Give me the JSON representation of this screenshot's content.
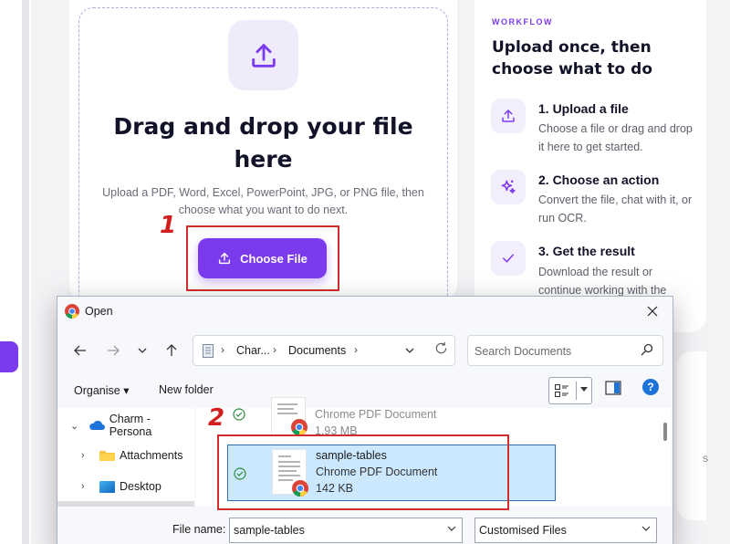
{
  "upload": {
    "title": "Drag and drop your file here",
    "subtitle": "Upload a PDF, Word, Excel, PowerPoint, JPG, or PNG file, then choose what you want to do next.",
    "choose_button": "Choose File"
  },
  "annotations": {
    "step1": "1",
    "step2": "2"
  },
  "workflow": {
    "label": "WORKFLOW",
    "title": "Upload once, then choose what to do",
    "steps": [
      {
        "title": "1. Upload a file",
        "desc": "Choose a file or drag and drop it here to get started.",
        "icon": "upload-icon"
      },
      {
        "title": "2. Choose an action",
        "desc": "Convert the file, chat with it, or run OCR.",
        "icon": "sparkle-icon"
      },
      {
        "title": "3. Get the result",
        "desc": "Download the result or continue working with the",
        "icon": "check-icon"
      }
    ]
  },
  "right_card_fragment": "s",
  "dialog": {
    "title": "Open",
    "address": {
      "seg1": "Char...",
      "seg2": "Documents"
    },
    "search_placeholder": "Search Documents",
    "commands": {
      "organise": "Organise ▾",
      "new_folder": "New folder"
    },
    "tree": [
      {
        "label": "Charm - Persona",
        "icon": "onedrive-cloud-icon"
      },
      {
        "label": "Attachments",
        "icon": "folder-icon"
      },
      {
        "label": "Desktop",
        "icon": "desktop-icon"
      }
    ],
    "files": [
      {
        "name": "",
        "type": "Chrome PDF Document",
        "size": "1.93 MB"
      },
      {
        "name": "sample-tables",
        "type": "Chrome PDF Document",
        "size": "142 KB"
      }
    ],
    "file_name_label": "File name:",
    "file_name_value": "sample-tables",
    "file_type_value": "Customised Files"
  },
  "colors": {
    "accent": "#7c3aed",
    "highlight": "#d12d2d",
    "selection": "#cce8ff"
  }
}
